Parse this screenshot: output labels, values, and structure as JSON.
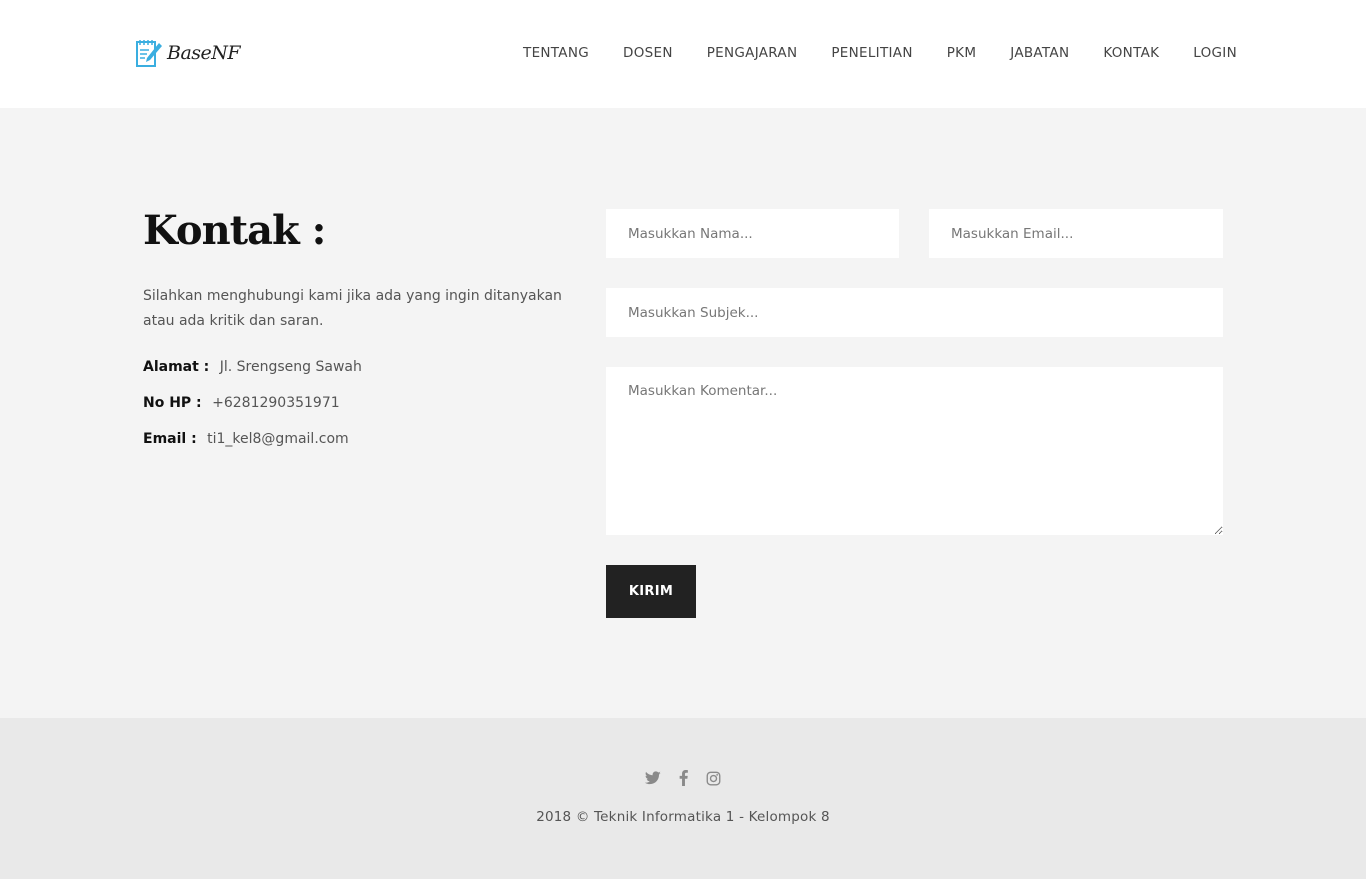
{
  "header": {
    "logo_text": "BaseNF",
    "nav": [
      {
        "label": "TENTANG"
      },
      {
        "label": "DOSEN"
      },
      {
        "label": "PENGAJARAN"
      },
      {
        "label": "PENELITIAN"
      },
      {
        "label": "PKM"
      },
      {
        "label": "JABATAN"
      },
      {
        "label": "KONTAK"
      },
      {
        "label": "LOGIN"
      }
    ]
  },
  "contact": {
    "title": "Kontak :",
    "description": "Silahkan menghubungi kami jika ada yang ingin ditanyakan atau ada kritik dan saran.",
    "address_label": "Alamat :",
    "address_value": "Jl. Srengseng Sawah",
    "phone_label": "No HP :",
    "phone_value": "+6281290351971",
    "email_label": "Email :",
    "email_value": "ti1_kel8@gmail.com"
  },
  "form": {
    "name_placeholder": "Masukkan Nama...",
    "email_placeholder": "Masukkan Email...",
    "subject_placeholder": "Masukkan Subjek...",
    "comment_placeholder": "Masukkan Komentar...",
    "submit_label": "KIRIM"
  },
  "footer": {
    "social_icons": [
      "twitter-icon",
      "facebook-icon",
      "instagram-icon"
    ],
    "copyright": "2018 © Teknik Informatika 1 - Kelompok 8"
  },
  "colors": {
    "header_bg": "#ffffff",
    "section_bg": "#f4f4f4",
    "footer_bg": "#e9e9e9",
    "button_bg": "#222222",
    "logo_accent": "#3aaee0"
  }
}
